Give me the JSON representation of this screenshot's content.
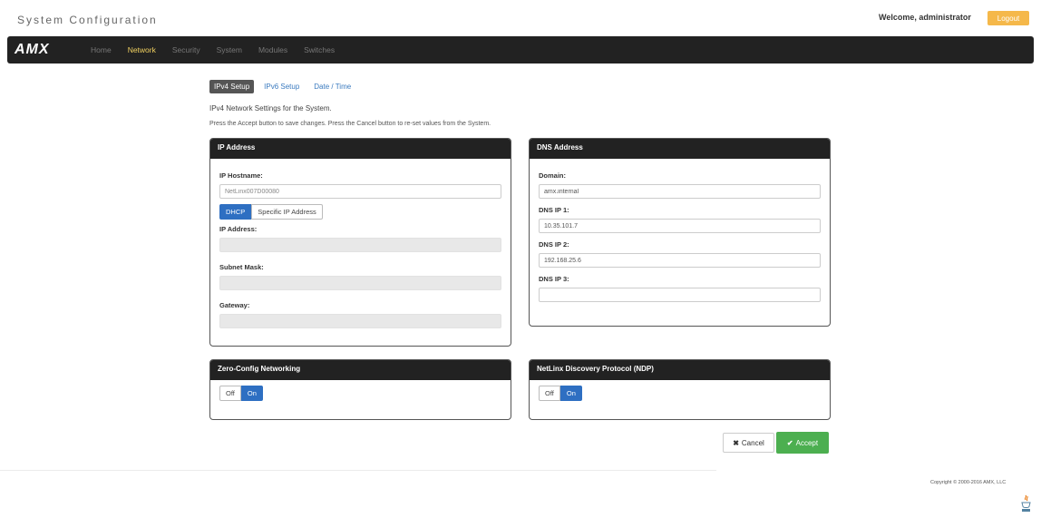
{
  "header": {
    "title": "System Configuration",
    "welcome": "Welcome, administrator",
    "logout_label": "Logout"
  },
  "nav": {
    "logo": "AMX",
    "items": [
      {
        "label": "Home",
        "active": false
      },
      {
        "label": "Network",
        "active": true
      },
      {
        "label": "Security",
        "active": false
      },
      {
        "label": "System",
        "active": false
      },
      {
        "label": "Modules",
        "active": false
      },
      {
        "label": "Switches",
        "active": false
      }
    ]
  },
  "tabs": [
    {
      "label": "IPv4 Setup",
      "active": true
    },
    {
      "label": "IPv6 Setup",
      "active": false
    },
    {
      "label": "Date / Time",
      "active": false
    }
  ],
  "description": {
    "line1": "IPv4 Network Settings for the System.",
    "line2": "Press the Accept button to save changes. Press the Cancel button to re-set values from the System."
  },
  "ip_panel": {
    "title": "IP Address",
    "hostname_label": "IP Hostname:",
    "hostname_value": "NetLinx007D00080",
    "dhcp_label": "DHCP",
    "specific_label": "Specific IP Address",
    "ip_label": "IP Address:",
    "ip_value": "",
    "subnet_label": "Subnet Mask:",
    "subnet_value": "",
    "gateway_label": "Gateway:",
    "gateway_value": ""
  },
  "dns_panel": {
    "title": "DNS Address",
    "domain_label": "Domain:",
    "domain_value": "amx.internal",
    "dns1_label": "DNS IP 1:",
    "dns1_value": "10.35.101.7",
    "dns2_label": "DNS IP 2:",
    "dns2_value": "192.168.25.6",
    "dns3_label": "DNS IP 3:",
    "dns3_value": ""
  },
  "zeroconf_panel": {
    "title": "Zero-Config Networking",
    "off_label": "Off",
    "on_label": "On"
  },
  "ndp_panel": {
    "title": "NetLinx Discovery Protocol (NDP)",
    "off_label": "Off",
    "on_label": "On"
  },
  "actions": {
    "cancel_label": "Cancel",
    "accept_label": "Accept"
  },
  "footer": {
    "copyright": "Copyright © 2000-2016 AMX, LLC"
  },
  "colors": {
    "navbar": "#222222",
    "active_nav": "#f0d060",
    "toggle_on": "#2e6fc2",
    "accept": "#4caf50",
    "logout": "#f5b84a"
  }
}
